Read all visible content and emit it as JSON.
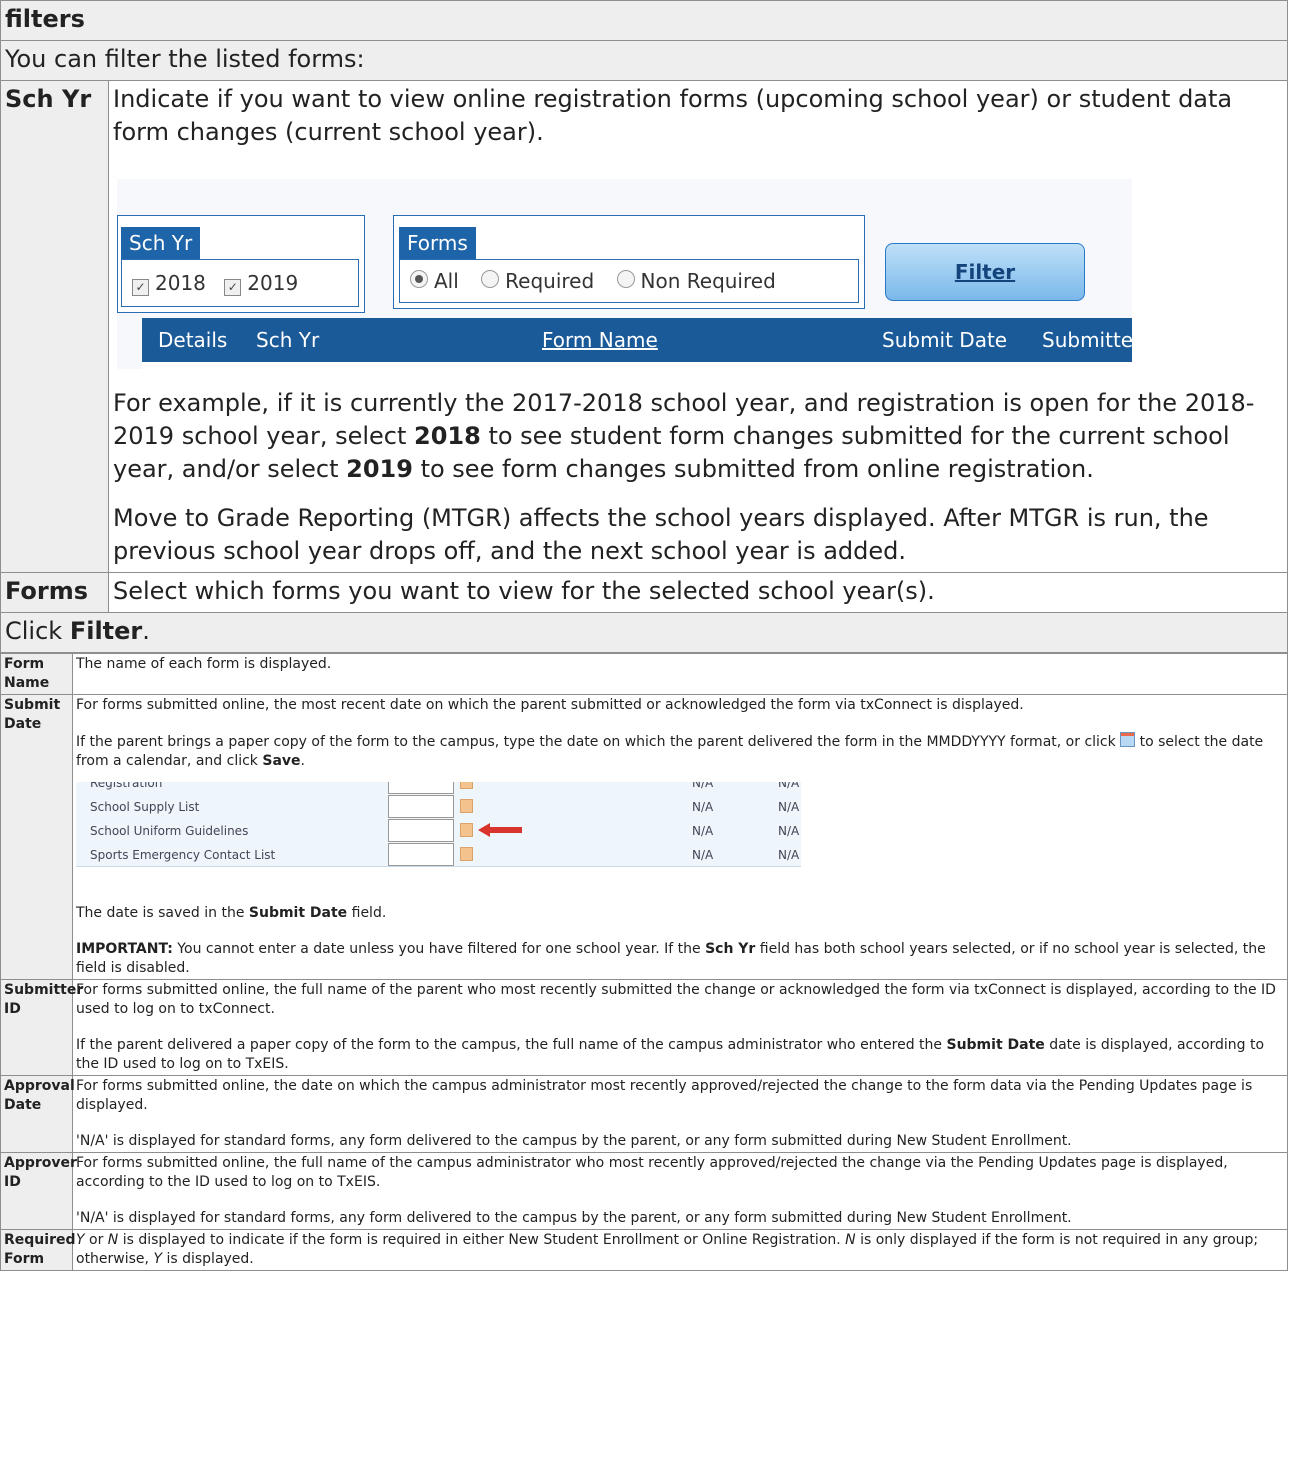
{
  "filters": {
    "title": "filters",
    "intro": "You can filter the listed forms:",
    "sch_yr": {
      "label": "Sch Yr",
      "desc": "Indicate if you want to view online registration forms (upcoming school year) or student data form changes (current school year).",
      "example_p1": "For example, if it is currently the 2017-2018 school year, and registration is open for the 2018-2019 school year, select ",
      "example_b1": "2018",
      "example_p2": " to see student form changes submitted for the current school year, and/or select ",
      "example_b2": "2019",
      "example_p3": " to see form changes submitted from online registration.",
      "mtgr_note": "Move to Grade Reporting (MTGR) affects the school years displayed. After MTGR is run, the previous school year drops off, and the next school year is added."
    },
    "forms": {
      "label": "Forms",
      "desc": "Select which forms you want to view for the selected school year(s)."
    },
    "click_pre": "Click ",
    "click_bold": "Filter",
    "click_post": "."
  },
  "screenshot1": {
    "sch_yr_title": "Sch Yr",
    "year1": "2018",
    "year2": "2019",
    "forms_title": "Forms",
    "opt_all": "All",
    "opt_required": "Required",
    "opt_non_required": "Non Required",
    "filter_button": "Filter",
    "col_details": "Details",
    "col_sch_yr": "Sch Yr",
    "col_form_name": "Form Name",
    "col_submit_date": "Submit Date",
    "col_submitter": "Submitte"
  },
  "fields": {
    "form_name": {
      "label": "Form Name",
      "desc": "The name of each form is displayed."
    },
    "submit_date": {
      "label": "Submit Date",
      "p1": "For forms submitted online, the most recent date on which the parent submitted or acknowledged the form via txConnect is displayed.",
      "p2a": "If the parent brings a paper copy of the form to the campus, type the date on which the parent delivered the form in the MMDDYYYY format, or click ",
      "p2b": " to select the date from a calendar, and click ",
      "p2bold": "Save",
      "p2c": ".",
      "p3a": "The date is saved in the ",
      "p3bold": "Submit Date",
      "p3b": " field.",
      "p4bold": "IMPORTANT:",
      "p4a": " You cannot enter a date unless you have filtered for one school year. If the ",
      "p4bold2": "Sch Yr",
      "p4b": " field has both school years selected, or if no school year is selected, the field is disabled."
    },
    "submitter_id": {
      "label": "Submitter ID",
      "p1": "For forms submitted online, the full name of the parent who most recently submitted the change or acknowledged the form via txConnect is displayed, according to the ID used to log on to txConnect.",
      "p2a": "If the parent delivered a paper copy of the form to the campus, the full name of the campus administrator who entered the ",
      "p2bold": "Submit Date",
      "p2b": " date is displayed, according to the ID used to log on to TxEIS."
    },
    "approval_date": {
      "label": "Approval Date",
      "p1": "For forms submitted online, the date on which the campus administrator most recently approved/rejected the change to the form data via the Pending Updates page is displayed.",
      "p2": "'N/A' is displayed for standard forms, any form delivered to the campus by the parent, or any form submitted during New Student Enrollment."
    },
    "approver_id": {
      "label": "Approver ID",
      "p1": "For forms submitted online, the full name of the campus administrator who most recently approved/rejected the change via the Pending Updates page is displayed, according to the ID used to log on to TxEIS.",
      "p2": "'N/A' is displayed for standard forms, any form delivered to the campus by the parent, or any form submitted during New Student Enrollment."
    },
    "required_form": {
      "label": "Required Form",
      "p1a": "Y",
      "p1b": " or ",
      "p1c": "N",
      "p1d": " is displayed to indicate if the form is required in either New Student Enrollment or Online Registration. ",
      "p1e": "N",
      "p1f": " is only displayed if the form is not required in any group; otherwise, ",
      "p1g": "Y",
      "p1h": " is displayed."
    }
  },
  "screenshot2": {
    "rows": [
      {
        "name": "Registration",
        "v1": "N/A",
        "v2": "N/A"
      },
      {
        "name": "School Supply List",
        "v1": "N/A",
        "v2": "N/A"
      },
      {
        "name": "School Uniform Guidelines",
        "v1": "N/A",
        "v2": "N/A"
      },
      {
        "name": "Sports Emergency Contact List",
        "v1": "N/A",
        "v2": "N/A"
      }
    ]
  },
  "colors": {
    "header_bg": "#eeeeee",
    "border": "#8e8e8e",
    "grid_header": "#1a5a99",
    "button_blue": "#7ab8ea",
    "arrow_red": "#d9342b"
  }
}
